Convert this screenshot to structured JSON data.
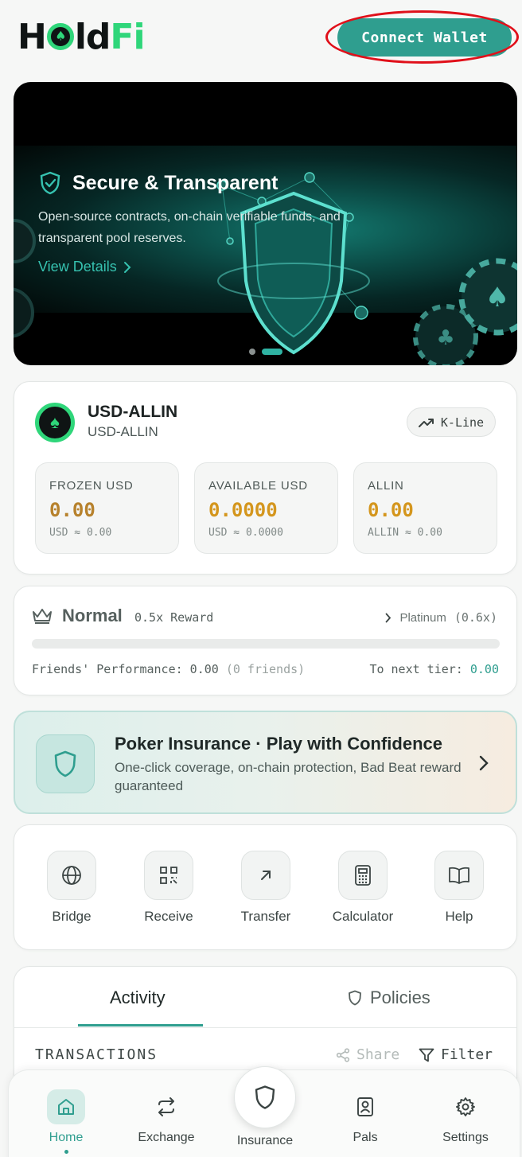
{
  "header": {
    "logo_text": "HoldFi",
    "connect_label": "Connect Wallet"
  },
  "banner": {
    "title": "Secure & Transparent",
    "description": "Open-source contracts, on-chain verifiable funds, and transparent pool reserves.",
    "link_label": "View Details",
    "slides": 2,
    "active_slide": 2
  },
  "token": {
    "name": "USD-ALLIN",
    "subtitle": "USD-ALLIN",
    "kline_label": "K-Line",
    "balances": [
      {
        "label": "FROZEN USD",
        "value": "0.00",
        "sub": "USD ≈ 0.00"
      },
      {
        "label": "AVAILABLE USD",
        "value": "0.0000",
        "sub": "USD ≈ 0.0000"
      },
      {
        "label": "ALLIN",
        "value": "0.00",
        "sub": "ALLIN ≈ 0.00"
      }
    ]
  },
  "tier": {
    "name": "Normal",
    "reward": "0.5x Reward",
    "next_tier": "Platinum",
    "next_multiplier": "(0.6x)",
    "progress": 0,
    "performance_label": "Friends' Performance: 0.00",
    "friends_count": "(0 friends)",
    "to_next_label": "To next tier:",
    "to_next_value": "0.00"
  },
  "promo": {
    "title": "Poker Insurance · Play with Confidence",
    "description": "One-click coverage, on-chain protection, Bad Beat reward guaranteed"
  },
  "actions": [
    {
      "label": "Bridge",
      "icon": "globe-icon"
    },
    {
      "label": "Receive",
      "icon": "qr-code-icon"
    },
    {
      "label": "Transfer",
      "icon": "arrow-up-right-icon"
    },
    {
      "label": "Calculator",
      "icon": "calculator-icon"
    },
    {
      "label": "Help",
      "icon": "book-icon"
    }
  ],
  "activity": {
    "tabs": [
      "Activity",
      "Policies"
    ],
    "active_tab": "Activity",
    "section_label": "TRANSACTIONS",
    "share_label": "Share",
    "filter_label": "Filter"
  },
  "nav": {
    "items": [
      {
        "label": "Home",
        "icon": "home-icon"
      },
      {
        "label": "Exchange",
        "icon": "swap-icon"
      },
      {
        "label": "Insurance",
        "icon": "shield-icon"
      },
      {
        "label": "Pals",
        "icon": "contact-card-icon"
      },
      {
        "label": "Settings",
        "icon": "gear-icon"
      }
    ],
    "active": "Home"
  },
  "colors": {
    "accent": "#2f9e8f",
    "brand_green": "#2fd67a",
    "balance_value": "#d4961d",
    "highlight_ring": "#e0101a"
  }
}
